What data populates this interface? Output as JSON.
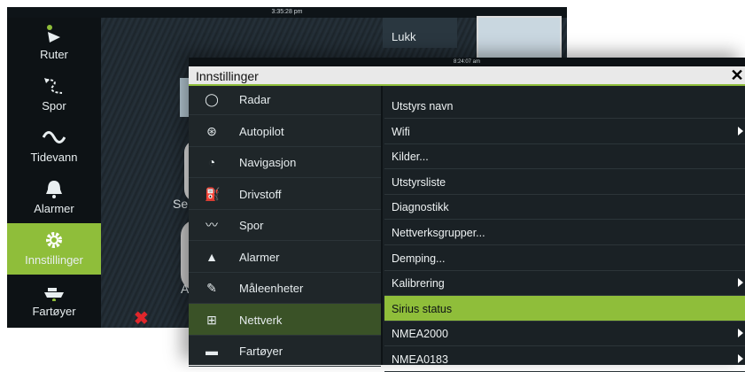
{
  "background": {
    "clock": "3:35:28 pm",
    "sidebar": [
      {
        "label": "Ruter",
        "icon": "route-icon"
      },
      {
        "label": "Spor",
        "icon": "trail-icon"
      },
      {
        "label": "Tidevann",
        "icon": "tide-icon"
      },
      {
        "label": "Alarmer",
        "icon": "bell-icon"
      },
      {
        "label": "Innstillinger",
        "icon": "gear-icon",
        "active": true
      },
      {
        "label": "Fartøyer",
        "icon": "vessel-icon"
      }
    ],
    "close_label": "Lukk",
    "partial_labels": [
      "Seil",
      "Au"
    ]
  },
  "dialog": {
    "clock": "8:24:07 am",
    "title": "Innstillinger",
    "left_items": [
      {
        "label": "Radar",
        "icon": "radar-icon"
      },
      {
        "label": "Autopilot",
        "icon": "autopilot-icon"
      },
      {
        "label": "Navigasjon",
        "icon": "compass-icon"
      },
      {
        "label": "Drivstoff",
        "icon": "fuel-icon"
      },
      {
        "label": "Spor",
        "icon": "trail-icon"
      },
      {
        "label": "Alarmer",
        "icon": "bell-icon"
      },
      {
        "label": "Måleenheter",
        "icon": "ruler-icon"
      },
      {
        "label": "Nettverk",
        "icon": "network-icon",
        "active": true
      },
      {
        "label": "Fartøyer",
        "icon": "vessel-icon"
      }
    ],
    "right_items": [
      {
        "label": "Utstyrs navn",
        "submenu": false
      },
      {
        "label": "Wifi",
        "submenu": true
      },
      {
        "label": "Kilder...",
        "submenu": false
      },
      {
        "label": "Utstyrsliste",
        "submenu": false
      },
      {
        "label": "Diagnostikk",
        "submenu": false
      },
      {
        "label": "Nettverksgrupper...",
        "submenu": false
      },
      {
        "label": "Demping...",
        "submenu": false
      },
      {
        "label": "Kalibrering",
        "submenu": true
      },
      {
        "label": "Sirius status",
        "submenu": false,
        "active": true
      },
      {
        "label": "NMEA2000",
        "submenu": true
      },
      {
        "label": "NMEA0183",
        "submenu": true
      }
    ]
  },
  "colors": {
    "accent": "#8fbe3a",
    "active_left": "#3a5227",
    "alert": "#e0262b"
  }
}
